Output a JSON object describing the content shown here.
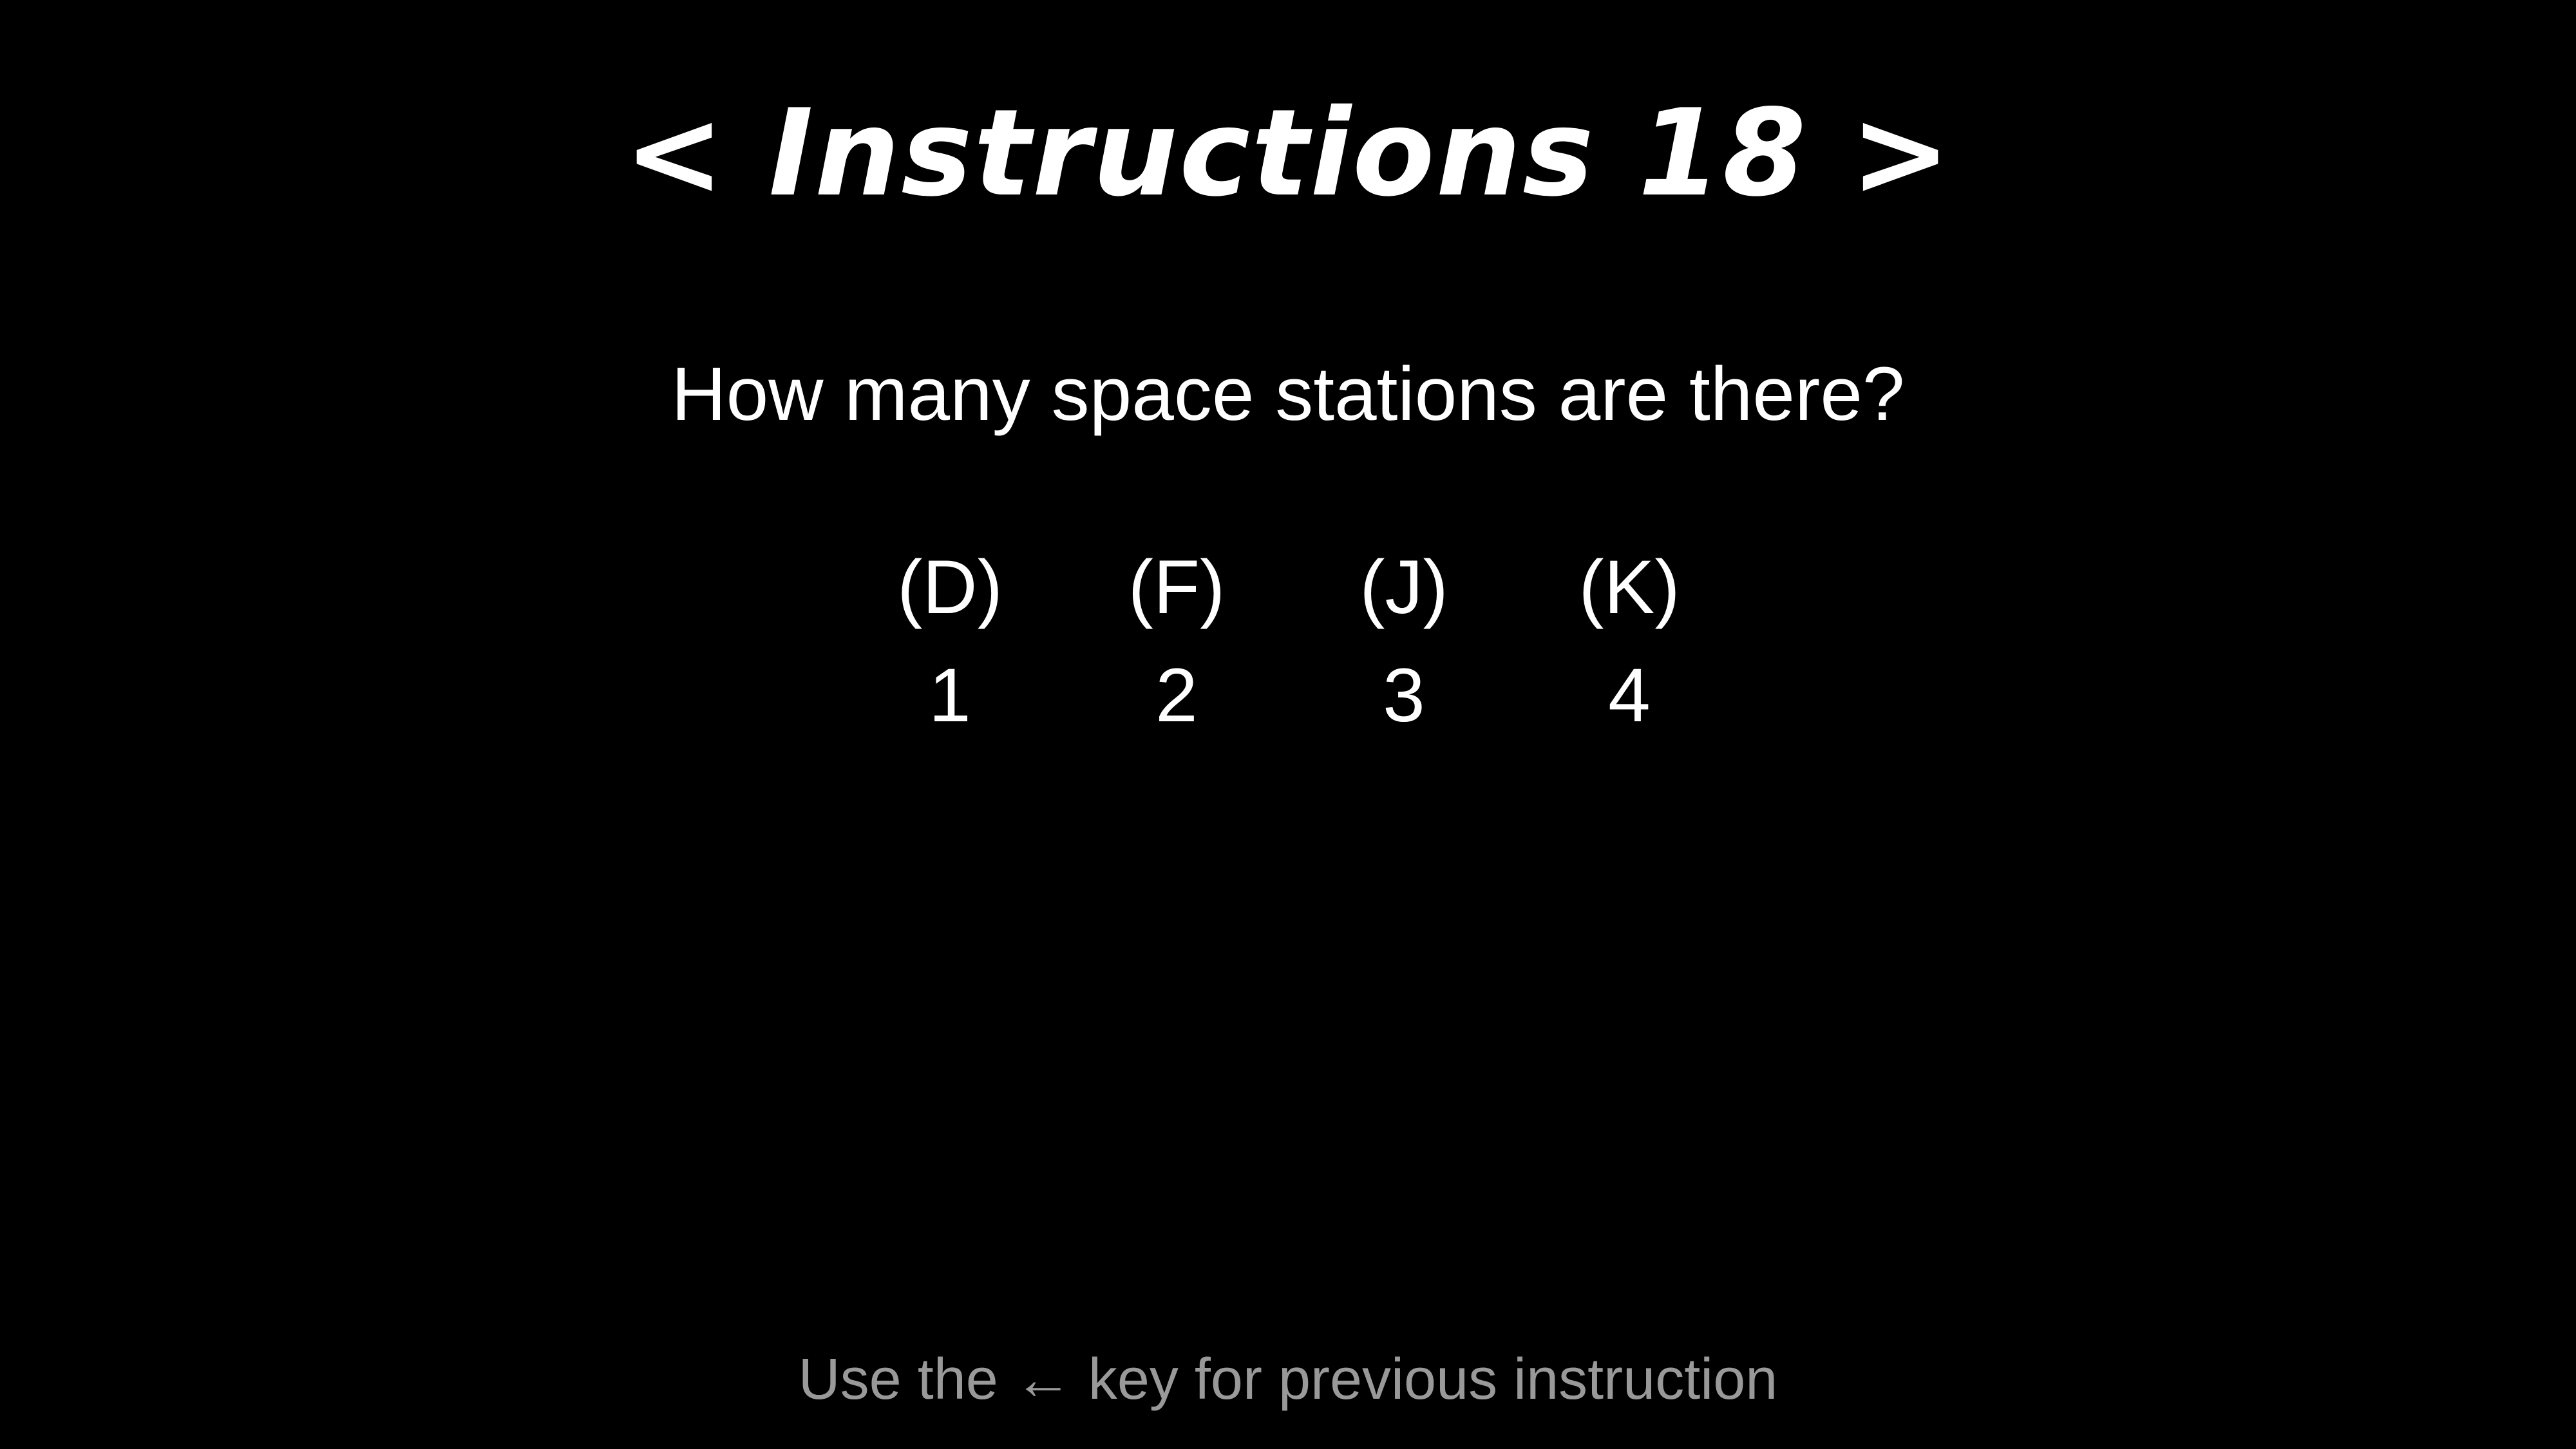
{
  "title": "< Instructions 18 >",
  "question": "How many space stations are there?",
  "options": [
    {
      "key": "(D)",
      "value": "1"
    },
    {
      "key": "(F)",
      "value": "2"
    },
    {
      "key": "(J)",
      "value": "3"
    },
    {
      "key": "(K)",
      "value": "4"
    }
  ],
  "footer": "Use the ← key for previous instruction",
  "colors": {
    "background": "#000000",
    "text": "#ffffff",
    "footer_text": "#999999"
  }
}
